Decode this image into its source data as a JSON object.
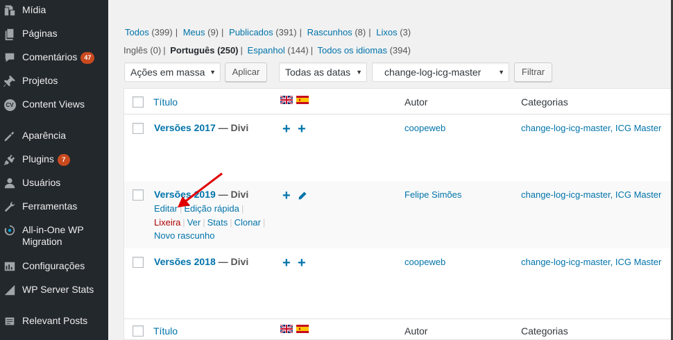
{
  "sidebar": {
    "items": [
      {
        "label": "Mídia",
        "icon": "media-icon"
      },
      {
        "label": "Páginas",
        "icon": "pages-icon"
      },
      {
        "label": "Comentários",
        "icon": "comments-icon",
        "badge": "47"
      },
      {
        "label": "Projetos",
        "icon": "pin-icon"
      },
      {
        "label": "Content Views",
        "icon": "content-views-icon",
        "icon_text": "CV"
      },
      {
        "label": "Aparência",
        "icon": "appearance-icon"
      },
      {
        "label": "Plugins",
        "icon": "plugins-icon",
        "badge": "7"
      },
      {
        "label": "Usuários",
        "icon": "users-icon"
      },
      {
        "label": "Ferramentas",
        "icon": "tools-icon"
      },
      {
        "label": "All-in-One WP Migration",
        "icon": "migration-icon"
      },
      {
        "label": "Configurações",
        "icon": "settings-icon"
      },
      {
        "label": "WP Server Stats",
        "icon": "stats-icon"
      },
      {
        "label": "Relevant Posts",
        "icon": "relevant-posts-icon"
      }
    ]
  },
  "filters": {
    "status": [
      {
        "label": "Todos",
        "count": "(399)"
      },
      {
        "label": "Meus",
        "count": "(9)"
      },
      {
        "label": "Publicados",
        "count": "(391)"
      },
      {
        "label": "Rascunhos",
        "count": "(8)"
      },
      {
        "label": "Lixos",
        "count": "(3)"
      }
    ],
    "languages": [
      {
        "label": "Inglês",
        "count": "(0)",
        "current": false,
        "link": false
      },
      {
        "label": "Português",
        "count": "(250)",
        "current": true,
        "link": false
      },
      {
        "label": "Espanhol",
        "count": "(144)",
        "current": false,
        "link": true
      },
      {
        "label": "Todos os idiomas",
        "count": "(394)",
        "current": false,
        "link": true
      }
    ]
  },
  "toolbar": {
    "bulk_action": "Ações em massa",
    "apply": "Aplicar",
    "dates": "Todas as datas",
    "category": "change-log-icg-master",
    "filter": "Filtrar"
  },
  "table": {
    "columns": {
      "title": "Título",
      "author": "Autor",
      "categories": "Categorias"
    },
    "rows": [
      {
        "title": "Versões 2017",
        "state": "— Divi",
        "author": "coopeweb",
        "categories": "change-log-icg-master, ICG Master"
      },
      {
        "title": "Versões 2019",
        "state": "— Divi",
        "author": "Felipe Simões",
        "categories": "change-log-icg-master, ICG Master",
        "actions": {
          "edit": "Editar",
          "quick_edit": "Edição rápida",
          "trash": "Lixeira",
          "view": "Ver",
          "stats": "Stats",
          "clone": "Clonar",
          "new_draft": "Novo rascunho"
        }
      },
      {
        "title": "Versões 2018",
        "state": "— Divi",
        "author": "coopeweb",
        "categories": "change-log-icg-master, ICG Master"
      }
    ]
  },
  "colors": {
    "sidebar_bg": "#23282d",
    "link": "#0073aa",
    "badge": "#ca4a1f",
    "trash": "#a00",
    "annotation_arrow": "#e00000"
  }
}
